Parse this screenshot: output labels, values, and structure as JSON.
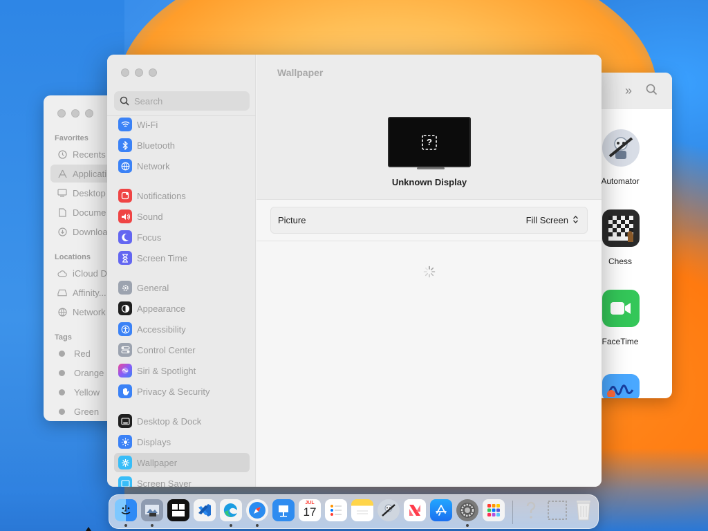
{
  "finder": {
    "favorites_header": "Favorites",
    "favorites": [
      "Recents",
      "Applicati",
      "Desktop",
      "Docume",
      "Downloa"
    ],
    "locations_header": "Locations",
    "locations": [
      "iCloud D",
      "Affinity...",
      "Network"
    ],
    "tags_header": "Tags",
    "tags": [
      {
        "label": "Red"
      },
      {
        "label": "Orange"
      },
      {
        "label": "Yellow"
      },
      {
        "label": "Green"
      }
    ]
  },
  "apps_window": {
    "items": [
      {
        "label": "Automator",
        "icon": "automator-icon",
        "color": "#d8dde6"
      },
      {
        "label": "Chess",
        "icon": "chess-icon",
        "color": "#2a2a2a"
      },
      {
        "label": "FaceTime",
        "icon": "facetime-icon",
        "color": "#34c759"
      },
      {
        "label": "",
        "icon": "freeform-icon",
        "color": "#4aa8ff"
      }
    ]
  },
  "settings": {
    "search_placeholder": "Search",
    "sidebar": [
      {
        "label": "Wi-Fi",
        "icon": "wifi-icon",
        "color": "#3b82f6"
      },
      {
        "label": "Bluetooth",
        "icon": "bluetooth-icon",
        "color": "#3b82f6"
      },
      {
        "label": "Network",
        "icon": "globe-icon",
        "color": "#3b82f6"
      },
      {
        "label": "Notifications",
        "icon": "bell-icon",
        "color": "#ef4444"
      },
      {
        "label": "Sound",
        "icon": "speaker-icon",
        "color": "#ef4444"
      },
      {
        "label": "Focus",
        "icon": "moon-icon",
        "color": "#6366f1"
      },
      {
        "label": "Screen Time",
        "icon": "hourglass-icon",
        "color": "#6366f1"
      },
      {
        "label": "General",
        "icon": "gear-icon",
        "color": "#9ca3af"
      },
      {
        "label": "Appearance",
        "icon": "appearance-icon",
        "color": "#1f1f1f"
      },
      {
        "label": "Accessibility",
        "icon": "accessibility-icon",
        "color": "#3b82f6"
      },
      {
        "label": "Control Center",
        "icon": "control-center-icon",
        "color": "#9ca3af"
      },
      {
        "label": "Siri & Spotlight",
        "icon": "siri-icon",
        "color": "#a855f7"
      },
      {
        "label": "Privacy & Security",
        "icon": "hand-icon",
        "color": "#3b82f6"
      },
      {
        "label": "Desktop & Dock",
        "icon": "dock-icon",
        "color": "#1f1f1f"
      },
      {
        "label": "Displays",
        "icon": "sun-icon",
        "color": "#3b82f6"
      },
      {
        "label": "Wallpaper",
        "icon": "wallpaper-icon",
        "color": "#38bdf8"
      },
      {
        "label": "Screen Saver",
        "icon": "screensaver-icon",
        "color": "#38bdf8"
      }
    ],
    "active_item": "Wallpaper",
    "main": {
      "title": "Wallpaper",
      "display_label": "Unknown Display",
      "display_glyph": "?",
      "picture_label": "Picture",
      "picture_value": "Fill Screen"
    }
  },
  "dock": {
    "items": [
      {
        "name": "finder-icon",
        "color": "#2e8af5",
        "running": true
      },
      {
        "name": "preview-icon",
        "color": "#6b7a90",
        "running": true
      },
      {
        "name": "mission-control-icon",
        "color": "#111111",
        "running": false
      },
      {
        "name": "vscode-icon",
        "color": "#1f6fd1",
        "running": false
      },
      {
        "name": "edge-icon",
        "color": "#1b9de2",
        "running": true
      },
      {
        "name": "safari-icon",
        "color": "#2a8cf0",
        "running": true
      },
      {
        "name": "keynote-icon",
        "color": "#2f8cf0",
        "running": false
      },
      {
        "name": "calendar-icon",
        "color": "#ffffff",
        "running": false,
        "month": "JUL",
        "day": "17"
      },
      {
        "name": "reminders-icon",
        "color": "#ffffff",
        "running": false
      },
      {
        "name": "notes-icon",
        "color": "#ffd54a",
        "running": false
      },
      {
        "name": "automator-icon",
        "color": "#cfd6df",
        "running": false
      },
      {
        "name": "news-icon",
        "color": "#ff3b4a",
        "running": false
      },
      {
        "name": "app-store-icon",
        "color": "#1e88f5",
        "running": false
      },
      {
        "name": "system-settings-icon",
        "color": "#7a7a7a",
        "running": true
      },
      {
        "name": "launchpad-icon",
        "color": "#f4f4f4",
        "running": false
      },
      {
        "name": "help-icon",
        "color": "#c8c8c8",
        "running": false
      },
      {
        "name": "screenshot-icon",
        "color": "#bdbdbd",
        "running": false
      },
      {
        "name": "trash-icon",
        "color": "#d9d9d9",
        "running": false
      }
    ]
  }
}
